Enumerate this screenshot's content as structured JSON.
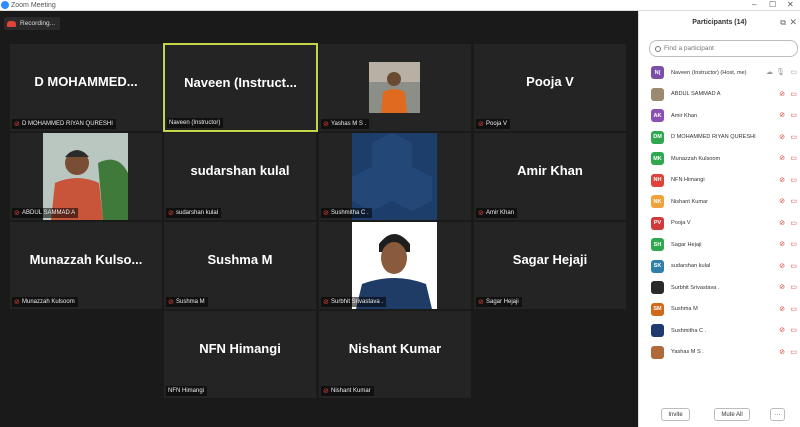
{
  "window": {
    "title": "Zoom Meeting",
    "minimize": "–",
    "maximize": "☐",
    "close": "✕"
  },
  "recording": {
    "label": "Recording..."
  },
  "tiles": [
    {
      "big": "D  MOHAMMED...",
      "name": "D MOHAMMED RIYAN QURESHI"
    },
    {
      "big": "Naveen  (Instruct...",
      "name": "Naveen (Instructor)"
    },
    {
      "big": "",
      "name": "Yashas M S ."
    },
    {
      "big": "Pooja V",
      "name": "Pooja V"
    },
    {
      "big": "",
      "name": "ABDUL SAMMAD A"
    },
    {
      "big": "sudarshan kulal",
      "name": "sudarshan kulal"
    },
    {
      "big": "",
      "name": "Sushmitha C ."
    },
    {
      "big": "Amir Khan",
      "name": "Amir Khan"
    },
    {
      "big": "Munazzah  Kulso...",
      "name": "Munazzah Kulsoom"
    },
    {
      "big": "Sushma M",
      "name": "Sushma M"
    },
    {
      "big": "",
      "name": "Surbhit Srivastava ."
    },
    {
      "big": "Sagar Hejaji",
      "name": "Sagar Hejaji"
    },
    {
      "big": "NFN Himangi",
      "name": "NFN Himangi"
    },
    {
      "big": "Nishant Kumar",
      "name": "Nishant Kumar"
    }
  ],
  "panel": {
    "title": "Participants (14)",
    "search_placeholder": "Find a participant",
    "invite": "Invite",
    "mute_all": "Mute All",
    "more": "···",
    "participants": [
      {
        "initials": "N(",
        "color": "#7c4fa8",
        "name": "Naveen (Instructor)  (Host, me)",
        "photo": false
      },
      {
        "initials": "",
        "color": "#9c8a70",
        "name": "ABDUL SAMMAD A",
        "photo": true
      },
      {
        "initials": "AK",
        "color": "#8a4fb0",
        "name": "Amir Khan",
        "photo": false
      },
      {
        "initials": "DM",
        "color": "#2fa84f",
        "name": "D MOHAMMED RIYAN QURESHI",
        "photo": false
      },
      {
        "initials": "MK",
        "color": "#2fa84f",
        "name": "Munazzah Kulsoom",
        "photo": false
      },
      {
        "initials": "NH",
        "color": "#e0433a",
        "name": "NFN Himangi",
        "photo": false
      },
      {
        "initials": "NK",
        "color": "#f2a23a",
        "name": "Nishant Kumar",
        "photo": false
      },
      {
        "initials": "PV",
        "color": "#d03a3a",
        "name": "Pooja V",
        "photo": false
      },
      {
        "initials": "SH",
        "color": "#2fa84f",
        "name": "Sagar Hejaji",
        "photo": false
      },
      {
        "initials": "SK",
        "color": "#2f7fa8",
        "name": "sudarshan kulal",
        "photo": false
      },
      {
        "initials": "",
        "color": "#2a2a2a",
        "name": "Surbhit Srivastava .",
        "photo": true
      },
      {
        "initials": "SM",
        "color": "#d06a1a",
        "name": "Sushma M",
        "photo": false
      },
      {
        "initials": "",
        "color": "#1e3a6e",
        "name": "Sushmitha C .",
        "photo": true
      },
      {
        "initials": "",
        "color": "#b06a3a",
        "name": "Yashas M S .",
        "photo": true
      }
    ]
  }
}
